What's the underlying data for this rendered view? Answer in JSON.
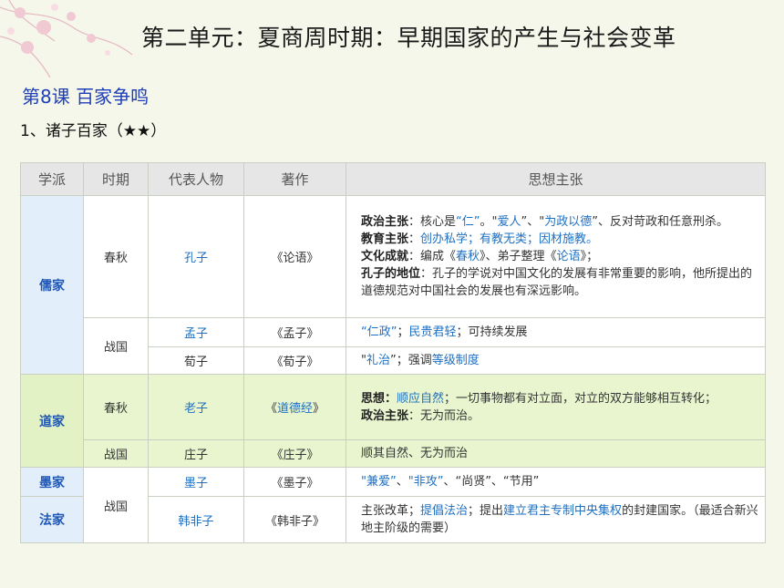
{
  "header": {
    "unit_title": "第二单元：夏商周时期：早期国家的产生与社会变革",
    "lesson_title": "第8课  百家争鸣",
    "section_title": "1、诸子百家（★★）"
  },
  "table": {
    "headers": [
      "学派",
      "时期",
      "代表人物",
      "著作",
      "思想主张"
    ],
    "confucian": {
      "school": "儒家",
      "period_a": "春秋",
      "period_b": "战国",
      "kongzi": {
        "name": "孔子",
        "work": "《论语》",
        "l1_label": "政治主张",
        "l1_a": "：核心是",
        "l1_b": "“仁”",
        "l1_c": "。\"",
        "l1_d": "爱人",
        "l1_e": "”、\"",
        "l1_f": "为政以德",
        "l1_g": "”、反对苛政和任意刑杀。",
        "l2_label": "教育主张",
        "l2_a": "：",
        "l2_b": "创办私学；有教无类；因材施教。",
        "l3_label": "文化成就",
        "l3_a": "：编成《",
        "l3_b": "春秋",
        "l3_c": "》、弟子整理《",
        "l3_d": "论语",
        "l3_e": "》；",
        "l4_label": "孔子的地位",
        "l4_a": "：孔子的学说对中国文化的发展有非常重要的影响，他所提出的道德规范对中国社会的发展也有深远影响。"
      },
      "mengzi": {
        "name": "孟子",
        "work": "《孟子》",
        "i_a": "“仁政”",
        "i_b": "；",
        "i_c": "民贵君轻",
        "i_d": "；可持续发展"
      },
      "xunzi": {
        "name": "荀子",
        "work": "《荀子》",
        "i_a": "\"",
        "i_b": "礼治",
        "i_c": "”；强调",
        "i_d": "等级制度"
      }
    },
    "taoist": {
      "school": "道家",
      "period_a": "春秋",
      "period_b": "战国",
      "laozi": {
        "name": "老子",
        "work_a": "《",
        "work_b": "道德经",
        "work_c": "》",
        "l1_label": "思想：",
        "l1_b": "顺应自然",
        "l1_c": "；一切事物都有对立面，对立的双方能够相互转化；",
        "l2_label": "政治主张",
        "l2_a": "：无为而治。"
      },
      "zhuangzi": {
        "name": "庄子",
        "work": "《庄子》",
        "ideas": "顺其自然、无为而治"
      }
    },
    "mohist": {
      "school": "墨家",
      "period": "战国",
      "name": "墨子",
      "work": "《墨子》",
      "i_a": "\"兼爱”",
      "i_b": "、",
      "i_c": "\"非攻”",
      "i_d": "、“尚贤”、“节用”"
    },
    "legalist": {
      "school": "法家",
      "name": "韩非子",
      "work": "《韩非子》",
      "i_a": "主张改革；",
      "i_b": "提倡法治",
      "i_c": "；提出",
      "i_d": "建立君主专制中央集权",
      "i_e": "的封建国家。（最适合新兴地主阶级的需要）"
    }
  }
}
